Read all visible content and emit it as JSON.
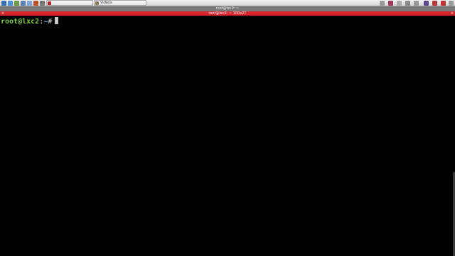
{
  "taskbar": {
    "tasks": [
      {
        "label": "",
        "icon": "terminal-icon"
      },
      {
        "label": "Vidéos",
        "icon": "folder-icon"
      }
    ],
    "colors": {
      "accent": "#d9232b",
      "taskbar_bg": "#e4e4e4"
    }
  },
  "window": {
    "title": "root@lxc2: ~",
    "buttons": [
      "minimize-icon",
      "maximize-icon",
      "close-icon"
    ]
  },
  "tab": {
    "title": "root@lxc2: ~ 100x27",
    "left_mark": "×",
    "close": "×"
  },
  "terminal": {
    "user_host": "root@lxc2",
    "separator": ":",
    "path": "~",
    "symbol": "#"
  }
}
